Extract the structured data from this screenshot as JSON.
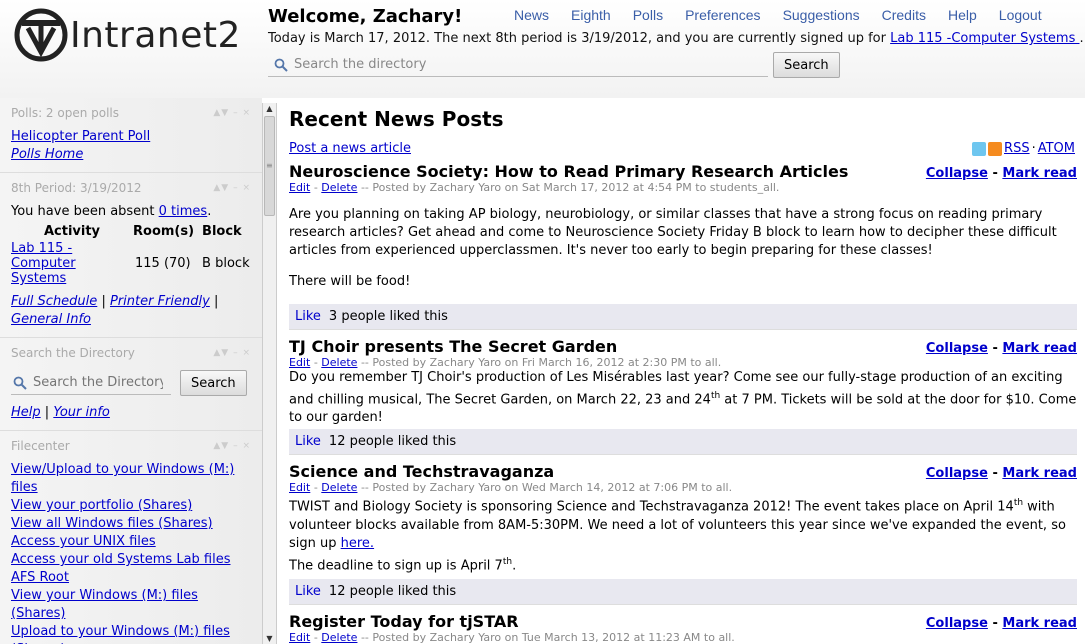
{
  "header": {
    "logo_text": "Intranet2",
    "welcome": "Welcome, Zachary!",
    "today_prefix": "Today is March 17, 2012. The next 8th period is 3/19/2012, and you are currently signed up for ",
    "today_link": "Lab 115 -Computer Systems ",
    "today_suffix": ".",
    "search_placeholder": "Search the directory",
    "search_button": "Search"
  },
  "nav": [
    "News",
    "Eighth",
    "Polls",
    "Preferences",
    "Suggestions",
    "Credits",
    "Help",
    "Logout"
  ],
  "sidebar": {
    "polls": {
      "title": "Polls: 2 open polls",
      "link1": "Helicopter Parent Poll",
      "link2": "Polls Home"
    },
    "eighth": {
      "title": "8th Period: 3/19/2012",
      "absent_prefix": "You have been absent ",
      "absent_link": "0 times",
      "absent_suffix": ".",
      "col_activity": "Activity",
      "col_rooms": "Room(s)",
      "col_block": "Block",
      "activity": "Lab 115 -Computer Systems",
      "rooms": "115 (70)",
      "block": "B block",
      "link_full": "Full Schedule",
      "link_printer": "Printer Friendly",
      "link_general": "General Info",
      "pipe": "|"
    },
    "directory": {
      "title": "Search the Directory",
      "placeholder": "Search the Directory",
      "button": "Search",
      "help": "Help",
      "info": "Your info",
      "pipe": "|"
    },
    "filecenter": {
      "title": "Filecenter",
      "links": [
        "View/Upload to your Windows (M:) files",
        "View your portfolio (Shares)",
        "View all Windows files (Shares)",
        "Access your UNIX files",
        "Access your old Systems Lab files",
        "AFS Root",
        "View your Windows (M:) files (Shares)",
        "Upload to your Windows (M:) files (Shares)"
      ]
    },
    "box_controls": "▲▼ – ×"
  },
  "main": {
    "heading": "Recent News Posts",
    "post_link": "Post a news article",
    "rss": "RSS",
    "dot": "·",
    "atom": "ATOM",
    "collapse": "Collapse",
    "dash": "-",
    "markread": "Mark read",
    "edit": "Edit",
    "delete": "Delete",
    "like": "Like",
    "posts": [
      {
        "title": "Neuroscience Society: How to Read Primary Research Articles",
        "meta": " -- Posted by Zachary Yaro on Sat March 17, 2012 at 4:54 PM to students_all.",
        "p1": "Are you planning on taking AP biology, neurobiology, or similar classes that have a strong focus on reading primary research articles?  Get ahead and come to Neuroscience Society Friday B block to learn how to decipher these difficult articles from experienced upperclassmen.  It's never too early to begin preparing for these classes!",
        "p2": "There will be food!",
        "likes": "3 people liked this"
      },
      {
        "title": "TJ Choir presents The Secret Garden",
        "meta": " -- Posted by Zachary Yaro on Fri March 16, 2012 at 2:30 PM to all.",
        "p1a": "Do you remember TJ Choir's production of Les Misérables last year?  Come see our fully-stage production of an exciting and chilling musical, The Secret Garden, on March 22, 23 and 24",
        "p1sup": "th",
        "p1b": " at 7 PM.  Tickets will be sold at the door for $10.  Come to our garden!",
        "likes": "12 people liked this"
      },
      {
        "title": "Science and Techstravaganza",
        "meta": " -- Posted by Zachary Yaro on Wed March 14, 2012 at 7:06 PM to all.",
        "p1a": "TWIST and Biology Society is sponsoring Science and Techstravaganza 2012! The event takes place on April 14",
        "p1sup": "th",
        "p1b": " with volunteer blocks available from 8AM-5:30PM.  We need a lot of volunteers this year since we've expanded the event, so sign up ",
        "p1link": "here.",
        "p2a": "The deadline to sign up is April 7",
        "p2sup": "th",
        "p2b": ".",
        "likes": "12 people liked this"
      },
      {
        "title": "Register Today for tjSTAR",
        "meta": " -- Posted by Zachary Yaro on Tue March 13, 2012 at 11:23 AM to all."
      }
    ]
  }
}
